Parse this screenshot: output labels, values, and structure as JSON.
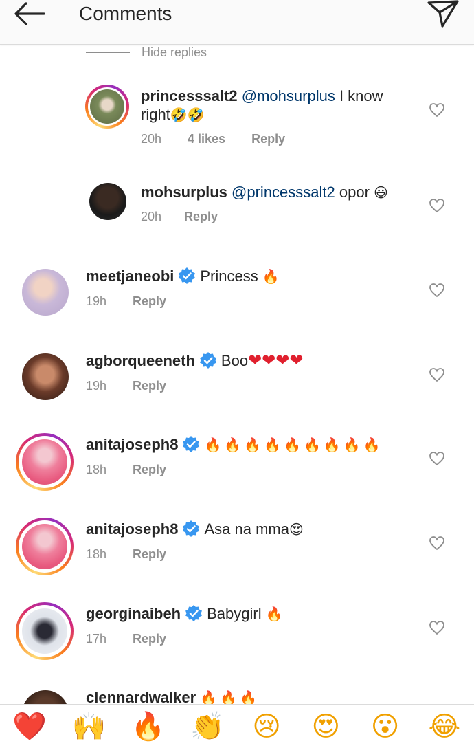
{
  "header": {
    "title": "Comments",
    "back_icon": "arrow-left-icon",
    "send_icon": "paper-plane-icon"
  },
  "hide_replies": "Hide replies",
  "comments": [
    {
      "username": "princesssalt2",
      "mention": "@mohsurplus",
      "text_line1": " I know",
      "text_line2": "right",
      "emoji_line2": "🤣🤣",
      "time": "20h",
      "likes": "4 likes",
      "reply": "Reply",
      "verified": false,
      "story_ring": true
    },
    {
      "username": "mohsurplus",
      "mention": "@princesssalt2",
      "text": " opor ",
      "emoji": "😃",
      "time": "20h",
      "reply": "Reply",
      "verified": false,
      "story_ring": false
    },
    {
      "username": "meetjaneobi",
      "text": "Princess ",
      "emoji": "🔥",
      "time": "19h",
      "reply": "Reply",
      "verified": true,
      "story_ring": false
    },
    {
      "username": "agborqueeneth",
      "text": "Boo",
      "emoji": "❤❤❤❤",
      "time": "19h",
      "reply": "Reply",
      "verified": true,
      "story_ring": false
    },
    {
      "username": "anitajoseph8",
      "text": "",
      "emoji": "🔥🔥🔥🔥🔥🔥🔥🔥🔥",
      "time": "18h",
      "reply": "Reply",
      "verified": true,
      "story_ring": true
    },
    {
      "username": "anitajoseph8",
      "text": "Asa na mma",
      "emoji": "😍",
      "time": "18h",
      "reply": "Reply",
      "verified": true,
      "story_ring": true
    },
    {
      "username": "georginaibeh",
      "text": "Babygirl ",
      "emoji": "🔥",
      "time": "17h",
      "reply": "Reply",
      "verified": true,
      "story_ring": true
    },
    {
      "username": "clennardwalker",
      "text": " ",
      "emoji": "🔥🔥🔥",
      "verified": false,
      "story_ring": false
    }
  ],
  "reactions": [
    "❤️",
    "🙌",
    "🔥",
    "👏",
    "😢",
    "😍",
    "😮",
    "😂"
  ],
  "colors": {
    "verified": "#3897f0",
    "mention": "#00376b",
    "muted": "#8e8e8e",
    "text": "#262626"
  }
}
